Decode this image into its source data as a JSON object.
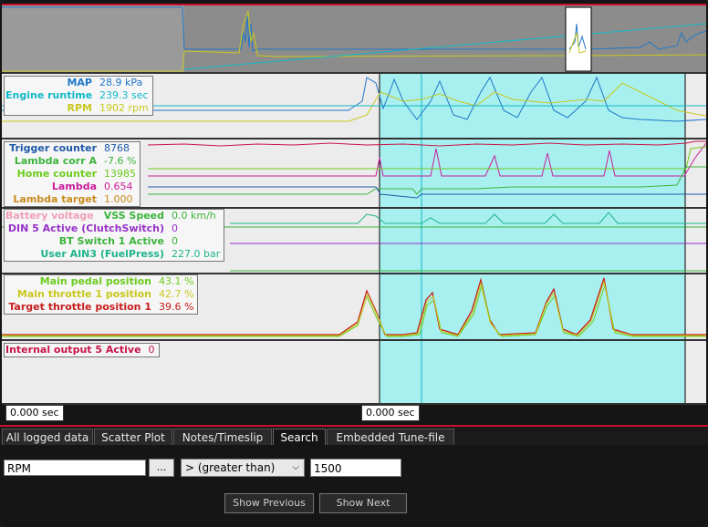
{
  "panels": {
    "p1": {
      "rows": [
        {
          "label": "MAP",
          "value": "28.9 kPa",
          "color": "#1f78c8"
        },
        {
          "label": "Engine runtime",
          "value": "239.3 sec",
          "color": "#0fb8c8"
        },
        {
          "label": "RPM",
          "value": "1902 rpm",
          "color": "#c8c81e"
        }
      ]
    },
    "p2": {
      "rows": [
        {
          "label": "Trigger counter",
          "value": "8768",
          "color": "#1e5aa8"
        },
        {
          "label": "Lambda corr A",
          "value": "-7.6 %",
          "color": "#3cb43c"
        },
        {
          "label": "Home counter",
          "value": "13985",
          "color": "#6ccc1e"
        },
        {
          "label": "Lambda",
          "value": "0.654",
          "color": "#c81e9a"
        },
        {
          "label": "Lambda target",
          "value": "1.000",
          "color": "#c88c1e"
        }
      ]
    },
    "p3": {
      "rows": [
        {
          "label": "Battery voltage",
          "value": "",
          "color": "#f0a0b4"
        },
        {
          "label": "VSS Speed",
          "value": "0.0 km/h",
          "color": "#3cb43c"
        },
        {
          "label": "DIN 5 Active (ClutchSwitch)",
          "value": "0",
          "color": "#9632c8"
        },
        {
          "label": "BT Switch 1 Active",
          "value": "0",
          "color": "#3cb43c"
        },
        {
          "label": "User AIN3 (FuelPress)",
          "value": "227.0 bar",
          "color": "#1eb48c"
        }
      ]
    },
    "p4": {
      "rows": [
        {
          "label": "Main pedal position",
          "value": "43.1 %",
          "color": "#6ccc1e"
        },
        {
          "label": "Main throttle 1 position",
          "value": "42.7 %",
          "color": "#c8c81e"
        },
        {
          "label": "Target throttle position 1",
          "value": "39.6 %",
          "color": "#c81e1e"
        }
      ]
    },
    "p5": {
      "rows": [
        {
          "label": "Internal output 5 Active",
          "value": "0",
          "color": "#c8144a"
        }
      ]
    }
  },
  "time_left": "0.000 sec",
  "time_cursor": "0.000 sec",
  "tabs": [
    {
      "label": "All logged data"
    },
    {
      "label": "Scatter Plot"
    },
    {
      "label": "Notes/Timeslip"
    },
    {
      "label": "Search"
    },
    {
      "label": "Embedded Tune-file"
    }
  ],
  "search": {
    "field_value": "RPM",
    "browse_label": "...",
    "operator": "> (greater than)",
    "threshold": "1500",
    "prev_label": "Show Previous",
    "next_label": "Show Next"
  }
}
